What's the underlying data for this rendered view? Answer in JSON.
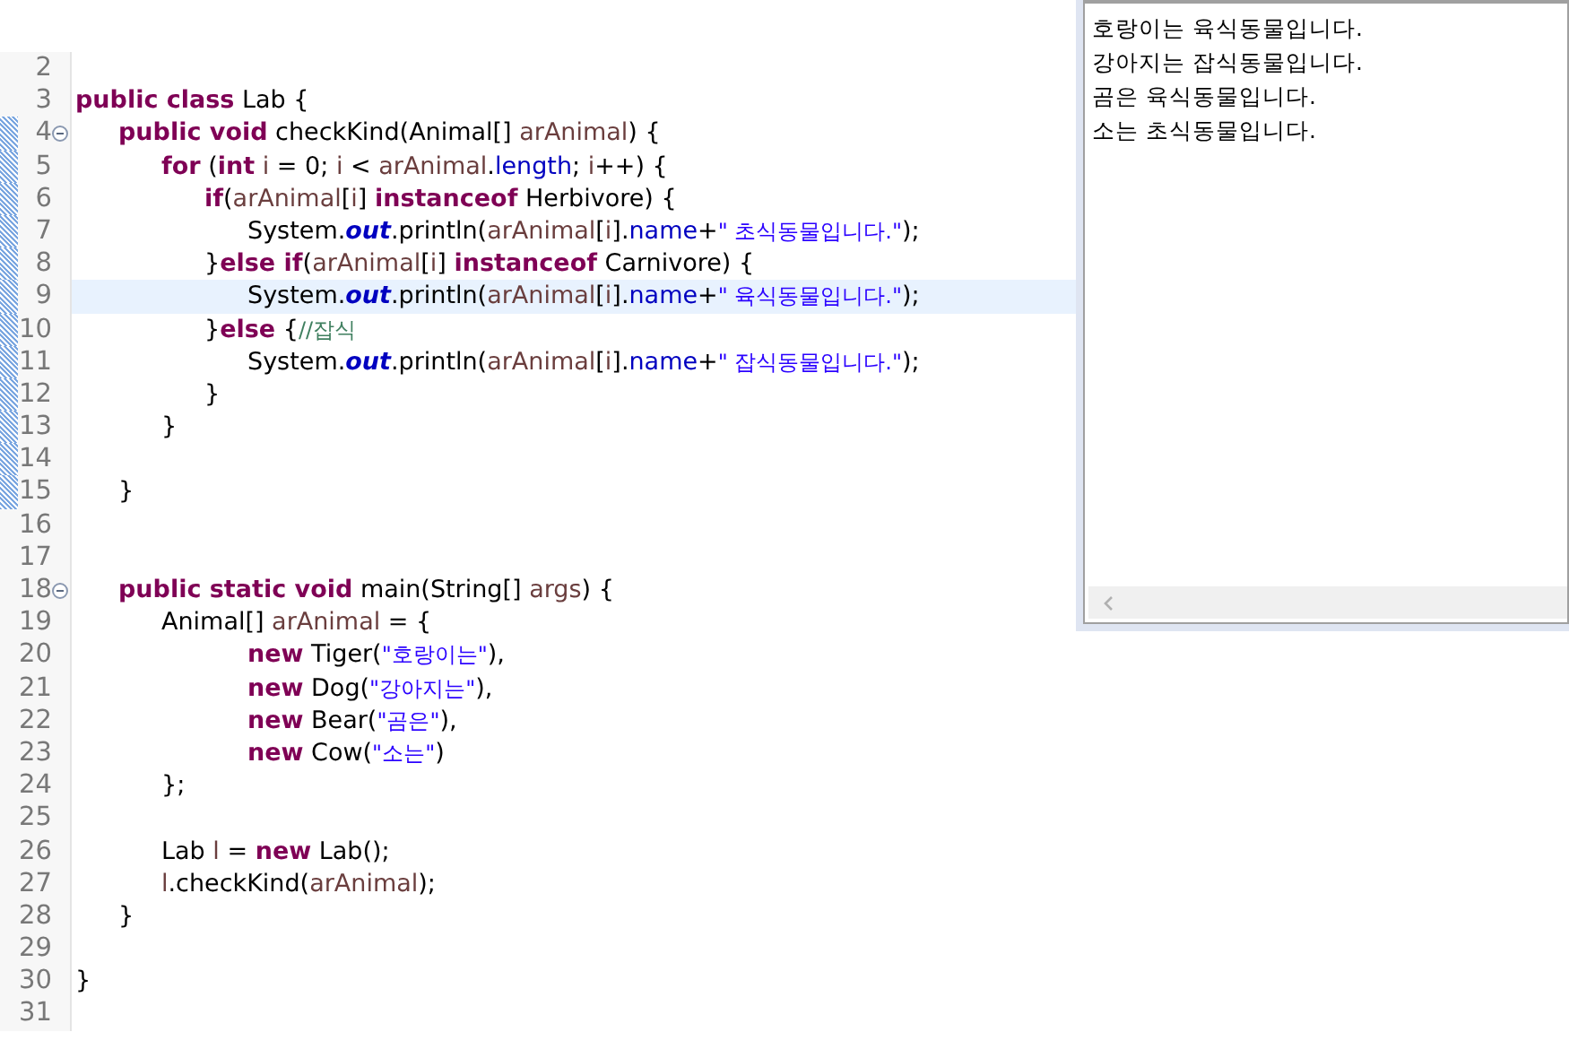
{
  "editor": {
    "lines": [
      {
        "num": "2"
      },
      {
        "num": "3",
        "tokens": [
          {
            "kind": "kw",
            "text": "public class"
          },
          {
            "kind": "plain",
            "text": " Lab {"
          }
        ]
      },
      {
        "num": "4",
        "fold": true,
        "tokens": [
          {
            "kind": "kw",
            "text": "\tpublic void"
          },
          {
            "kind": "plain",
            "text": " checkKind(Animal[] "
          },
          {
            "kind": "var",
            "text": "arAnimal"
          },
          {
            "kind": "plain",
            "text": ") {"
          }
        ]
      },
      {
        "num": "5",
        "tokens": [
          {
            "kind": "kw",
            "text": "\t\tfor"
          },
          {
            "kind": "plain",
            "text": " ("
          },
          {
            "kind": "kw",
            "text": "int"
          },
          {
            "kind": "var",
            "text": " i"
          },
          {
            "kind": "plain",
            "text": " = 0; "
          },
          {
            "kind": "var",
            "text": "i"
          },
          {
            "kind": "plain",
            "text": " < "
          },
          {
            "kind": "var",
            "text": "arAnimal"
          },
          {
            "kind": "plain",
            "text": "."
          },
          {
            "kind": "field",
            "text": "length"
          },
          {
            "kind": "plain",
            "text": "; "
          },
          {
            "kind": "var",
            "text": "i"
          },
          {
            "kind": "plain",
            "text": "++) {"
          }
        ]
      },
      {
        "num": "6",
        "tokens": [
          {
            "kind": "kw",
            "text": "\t\t\tif"
          },
          {
            "kind": "plain",
            "text": "("
          },
          {
            "kind": "var",
            "text": "arAnimal"
          },
          {
            "kind": "plain",
            "text": "["
          },
          {
            "kind": "var",
            "text": "i"
          },
          {
            "kind": "plain",
            "text": "] "
          },
          {
            "kind": "kw",
            "text": "instanceof"
          },
          {
            "kind": "plain",
            "text": " Herbivore) {"
          }
        ]
      },
      {
        "num": "7",
        "tokens": [
          {
            "kind": "plain",
            "text": "\t\t\t\tSystem."
          },
          {
            "kind": "static",
            "text": "out"
          },
          {
            "kind": "plain",
            "text": ".println("
          },
          {
            "kind": "var",
            "text": "arAnimal"
          },
          {
            "kind": "plain",
            "text": "["
          },
          {
            "kind": "var",
            "text": "i"
          },
          {
            "kind": "plain",
            "text": "]."
          },
          {
            "kind": "field",
            "text": "name"
          },
          {
            "kind": "plain",
            "text": "+"
          },
          {
            "kind": "str",
            "text": "\" 초식동물입니다.\""
          },
          {
            "kind": "plain",
            "text": ");"
          }
        ]
      },
      {
        "num": "8",
        "tokens": [
          {
            "kind": "plain",
            "text": "\t\t\t}"
          },
          {
            "kind": "kw",
            "text": "else if"
          },
          {
            "kind": "plain",
            "text": "("
          },
          {
            "kind": "var",
            "text": "arAnimal"
          },
          {
            "kind": "plain",
            "text": "["
          },
          {
            "kind": "var",
            "text": "i"
          },
          {
            "kind": "plain",
            "text": "] "
          },
          {
            "kind": "kw",
            "text": "instanceof"
          },
          {
            "kind": "plain",
            "text": " Carnivore) {"
          }
        ]
      },
      {
        "num": "9",
        "current": true,
        "tokens": [
          {
            "kind": "plain",
            "text": "\t\t\t\tSystem."
          },
          {
            "kind": "static",
            "text": "out"
          },
          {
            "kind": "plain",
            "text": ".println("
          },
          {
            "kind": "var",
            "text": "arAnimal"
          },
          {
            "kind": "plain",
            "text": "["
          },
          {
            "kind": "var",
            "text": "i"
          },
          {
            "kind": "plain",
            "text": "]."
          },
          {
            "kind": "field",
            "text": "name"
          },
          {
            "kind": "plain",
            "text": "+"
          },
          {
            "kind": "str",
            "text": "\" 육식동물입니다.\""
          },
          {
            "kind": "plain",
            "text": ");"
          }
        ]
      },
      {
        "num": "10",
        "tokens": [
          {
            "kind": "plain",
            "text": "\t\t\t}"
          },
          {
            "kind": "kw",
            "text": "else"
          },
          {
            "kind": "plain",
            "text": " {"
          },
          {
            "kind": "comment",
            "text": "//잡식"
          }
        ]
      },
      {
        "num": "11",
        "tokens": [
          {
            "kind": "plain",
            "text": "\t\t\t\tSystem."
          },
          {
            "kind": "static",
            "text": "out"
          },
          {
            "kind": "plain",
            "text": ".println("
          },
          {
            "kind": "var",
            "text": "arAnimal"
          },
          {
            "kind": "plain",
            "text": "["
          },
          {
            "kind": "var",
            "text": "i"
          },
          {
            "kind": "plain",
            "text": "]."
          },
          {
            "kind": "field",
            "text": "name"
          },
          {
            "kind": "plain",
            "text": "+"
          },
          {
            "kind": "str",
            "text": "\" 잡식동물입니다.\""
          },
          {
            "kind": "plain",
            "text": ");"
          }
        ]
      },
      {
        "num": "12",
        "tokens": [
          {
            "kind": "plain",
            "text": "\t\t\t}"
          }
        ]
      },
      {
        "num": "13",
        "tokens": [
          {
            "kind": "plain",
            "text": "\t\t}"
          }
        ]
      },
      {
        "num": "14"
      },
      {
        "num": "15",
        "tokens": [
          {
            "kind": "plain",
            "text": "\t}"
          }
        ]
      },
      {
        "num": "16"
      },
      {
        "num": "17"
      },
      {
        "num": "18",
        "fold": true,
        "tokens": [
          {
            "kind": "kw",
            "text": "\tpublic static void"
          },
          {
            "kind": "plain",
            "text": " main(String[] "
          },
          {
            "kind": "var",
            "text": "args"
          },
          {
            "kind": "plain",
            "text": ") {"
          }
        ]
      },
      {
        "num": "19",
        "tokens": [
          {
            "kind": "plain",
            "text": "\t\tAnimal[] "
          },
          {
            "kind": "var",
            "text": "arAnimal"
          },
          {
            "kind": "plain",
            "text": " = {"
          }
        ]
      },
      {
        "num": "20",
        "tokens": [
          {
            "kind": "kw",
            "text": "\t\t\t\tnew"
          },
          {
            "kind": "plain",
            "text": " Tiger("
          },
          {
            "kind": "str",
            "text": "\"호랑이는\""
          },
          {
            "kind": "plain",
            "text": "),"
          }
        ]
      },
      {
        "num": "21",
        "tokens": [
          {
            "kind": "kw",
            "text": "\t\t\t\tnew"
          },
          {
            "kind": "plain",
            "text": " Dog("
          },
          {
            "kind": "str",
            "text": "\"강아지는\""
          },
          {
            "kind": "plain",
            "text": "),"
          }
        ]
      },
      {
        "num": "22",
        "tokens": [
          {
            "kind": "kw",
            "text": "\t\t\t\tnew"
          },
          {
            "kind": "plain",
            "text": " Bear("
          },
          {
            "kind": "str",
            "text": "\"곰은\""
          },
          {
            "kind": "plain",
            "text": "),"
          }
        ]
      },
      {
        "num": "23",
        "tokens": [
          {
            "kind": "kw",
            "text": "\t\t\t\tnew"
          },
          {
            "kind": "plain",
            "text": " Cow("
          },
          {
            "kind": "str",
            "text": "\"소는\""
          },
          {
            "kind": "plain",
            "text": ")"
          }
        ]
      },
      {
        "num": "24",
        "tokens": [
          {
            "kind": "plain",
            "text": "\t\t};"
          }
        ]
      },
      {
        "num": "25"
      },
      {
        "num": "26",
        "tokens": [
          {
            "kind": "plain",
            "text": "\t\tLab "
          },
          {
            "kind": "var",
            "text": "l"
          },
          {
            "kind": "plain",
            "text": " = "
          },
          {
            "kind": "kw",
            "text": "new"
          },
          {
            "kind": "plain",
            "text": " Lab();"
          }
        ]
      },
      {
        "num": "27",
        "tokens": [
          {
            "kind": "var",
            "text": "\t\tl"
          },
          {
            "kind": "plain",
            "text": ".checkKind("
          },
          {
            "kind": "var",
            "text": "arAnimal"
          },
          {
            "kind": "plain",
            "text": ");"
          }
        ]
      },
      {
        "num": "28",
        "tokens": [
          {
            "kind": "plain",
            "text": "\t}"
          }
        ]
      },
      {
        "num": "29"
      },
      {
        "num": "30",
        "tokens": [
          {
            "kind": "plain",
            "text": "}"
          }
        ]
      },
      {
        "num": "31"
      }
    ]
  },
  "console": {
    "output": [
      "호랑이는 육식동물입니다.",
      "강아지는 잡식동물입니다.",
      "곰은 육식동물입니다.",
      "소는 초식동물입니다."
    ]
  }
}
